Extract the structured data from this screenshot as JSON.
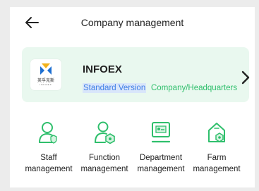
{
  "header": {
    "title": "Company management",
    "back_icon": "arrow-left-icon"
  },
  "company": {
    "name": "INFOEX",
    "logo_text": "英孚克斯",
    "logo_subtext": "INFOEX",
    "edition": "Standard Version",
    "role": "Company/Headquarters",
    "chevron_icon": "chevron-right-icon"
  },
  "functions": [
    {
      "line1": "Staff",
      "line2": "management",
      "icon": "staff-icon"
    },
    {
      "line1": "Function",
      "line2": "management",
      "icon": "function-icon"
    },
    {
      "line1": "Department",
      "line2": "management",
      "icon": "department-icon"
    },
    {
      "line1": "Farm",
      "line2": "management",
      "icon": "farm-icon"
    }
  ],
  "colors": {
    "accent_green": "#2fbf6c",
    "card_background": "#e9f8ef",
    "edition_blue": "#3f7fe6"
  }
}
